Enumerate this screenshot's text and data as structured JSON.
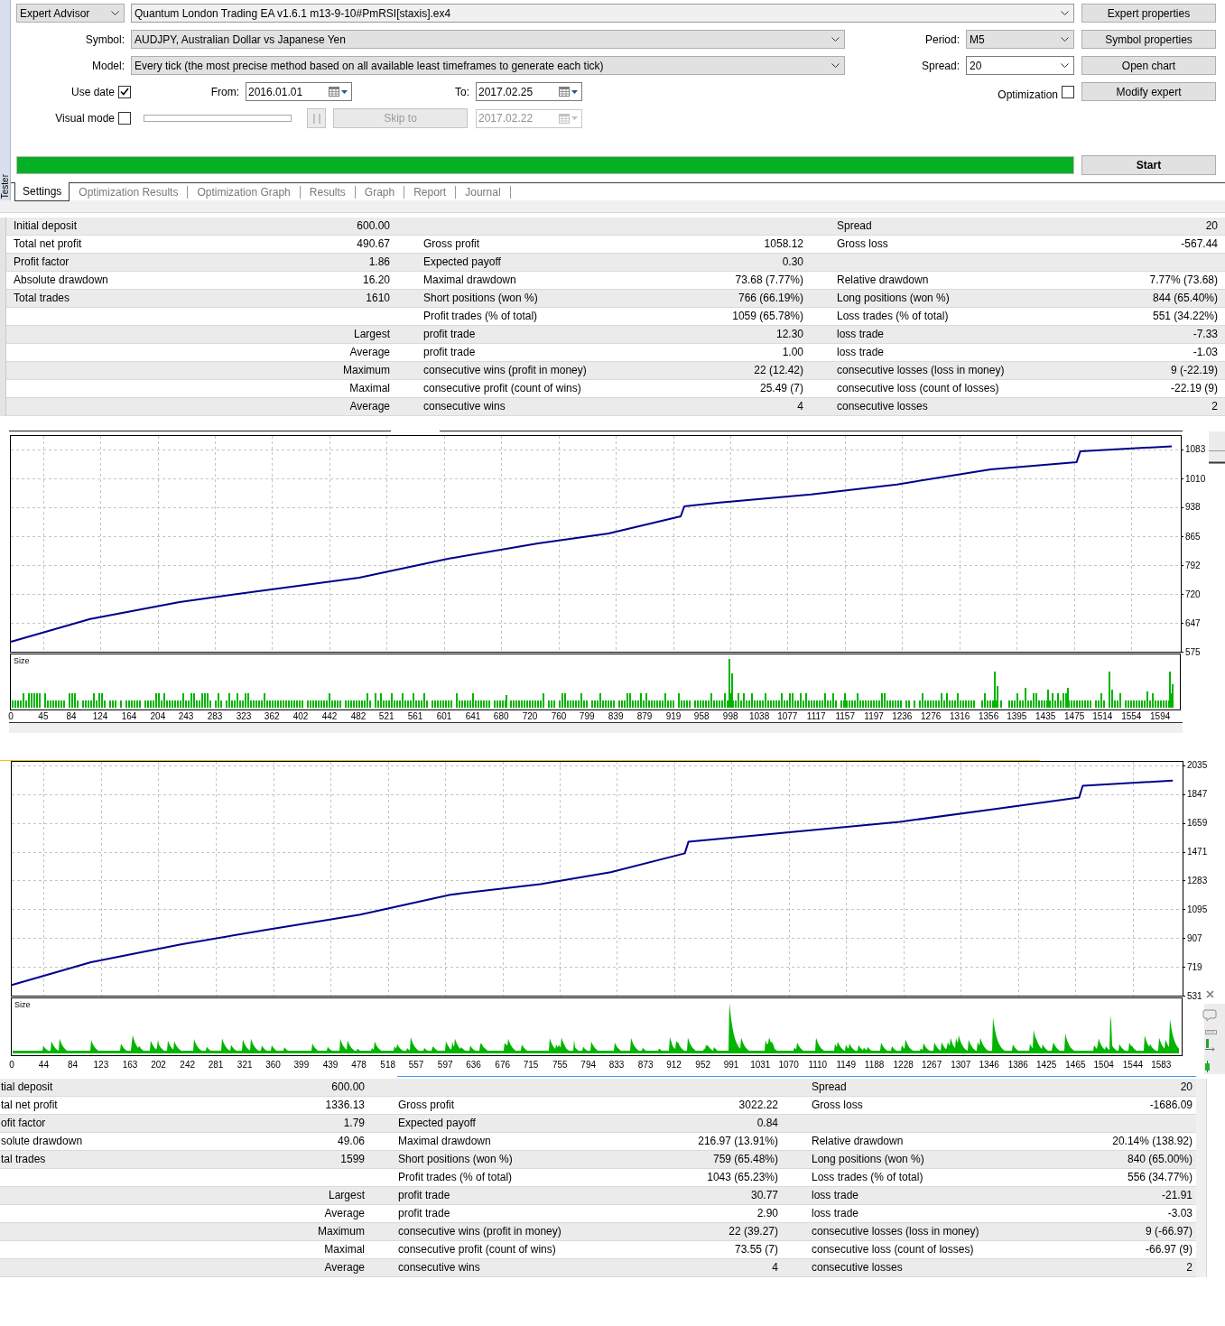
{
  "side_tab": {
    "label": "Tester"
  },
  "settings": {
    "expert_type": {
      "value": "Expert Advisor",
      "editable": false
    },
    "expert_file": {
      "value": "Quantum London Trading EA v1.6.1 m13-9-10#PmRSI[staxis].ex4",
      "editable": false
    },
    "expert_properties_button": {
      "label": "Expert properties"
    },
    "symbol": {
      "label": "Symbol:",
      "value": "AUDJPY, Australian Dollar vs Japanese Yen",
      "editable": false
    },
    "period": {
      "label": "Period:",
      "value": "M5",
      "editable": false
    },
    "symbol_properties_button": {
      "label": "Symbol properties"
    },
    "model": {
      "label": "Model:",
      "value": "Every tick (the most precise method based on all available least timeframes to generate each tick)",
      "editable": false
    },
    "spread": {
      "label": "Spread:",
      "value": "20",
      "editable": true
    },
    "open_chart_button": {
      "label": "Open chart"
    },
    "use_date": {
      "label": "Use date",
      "checked": true
    },
    "from": {
      "label": "From:",
      "value": "2016.01.01"
    },
    "to": {
      "label": "To:",
      "value": "2017.02.25"
    },
    "optimization": {
      "label": "Optimization",
      "checked": false
    },
    "modify_expert_button": {
      "label": "Modify expert"
    },
    "visual_mode": {
      "label": "Visual mode",
      "checked": false
    },
    "pause_button": {
      "disabled": true
    },
    "skip_button": {
      "label": "Skip to",
      "disabled": true
    },
    "skip_date": {
      "value": "2017.02.22",
      "disabled": true
    },
    "progress": {
      "level": 1
    },
    "start_button": {
      "label": "Start"
    }
  },
  "tabs": [
    {
      "label": "Settings",
      "selected": true
    },
    {
      "label": "Optimization Results",
      "selected": false
    },
    {
      "label": "Optimization Graph",
      "selected": false
    },
    {
      "label": "Results",
      "selected": false
    },
    {
      "label": "Graph",
      "selected": false
    },
    {
      "label": "Report",
      "selected": false
    },
    {
      "label": "Journal",
      "selected": false
    }
  ],
  "results_1": {
    "rows": [
      {
        "col_1": "Initial deposit",
        "col_2": "600.00",
        "col_5": "Spread",
        "col_6": "20"
      },
      {
        "col_1": "Total net profit",
        "col_2": "490.67",
        "col_3": "Gross profit",
        "col_4": "1058.12",
        "col_5": "Gross loss",
        "col_6": "-567.44"
      },
      {
        "col_1": "Profit factor",
        "col_2": "1.86",
        "col_3": "Expected payoff",
        "col_4": "0.30"
      },
      {
        "col_1": "Absolute drawdown",
        "col_2": "16.20",
        "col_3": "Maximal drawdown",
        "col_4": "73.68 (7.77%)",
        "col_5": "Relative drawdown",
        "col_6": "7.77% (73.68)"
      },
      {
        "col_1": "Total trades",
        "col_2": "1610",
        "col_3": "Short positions (won %)",
        "col_4": "766 (66.19%)",
        "col_5": "Long positions (won %)",
        "col_6": "844 (65.40%)"
      },
      {
        "col_3": "Profit trades (% of total)",
        "col_4": "1059 (65.78%)",
        "col_5": "Loss trades (% of total)",
        "col_6": "551 (34.22%)"
      },
      {
        "col_2": "Largest",
        "col_3": "profit trade",
        "col_4": "12.30",
        "col_5": "loss trade",
        "col_6": "-7.33"
      },
      {
        "col_2": "Average",
        "col_3": "profit trade",
        "col_4": "1.00",
        "col_5": "loss trade",
        "col_6": "-1.03"
      },
      {
        "col_2": "Maximum",
        "col_3": "consecutive wins (profit in money)",
        "col_4": "22 (12.42)",
        "col_5": "consecutive losses (loss in money)",
        "col_6": "9 (-22.19)"
      },
      {
        "col_2": "Maximal",
        "col_3": "consecutive profit (count of wins)",
        "col_4": "25.49 (7)",
        "col_5": "consecutive loss (count of losses)",
        "col_6": "-22.19 (9)"
      },
      {
        "col_2": "Average",
        "col_3": "consecutive wins",
        "col_4": "4",
        "col_5": "consecutive losses",
        "col_6": "2"
      }
    ]
  },
  "chart_1": {
    "size_label": "Size",
    "chart_data": {
      "type": "line",
      "grid": true,
      "x": [
        0,
        110,
        234,
        359,
        483,
        608,
        731,
        829,
        929,
        934,
        980,
        1110,
        1229,
        1359,
        1478,
        1483,
        1610
      ],
      "series": [
        {
          "color": "#00008b",
          "values": [
            600,
            657,
            700,
            731,
            761,
            809,
            847,
            872,
            915,
            940,
            949,
            970,
            995,
            1033,
            1051,
            1078,
            1091
          ]
        }
      ],
      "xlim": [
        0,
        1620
      ],
      "ylim": [
        575,
        1119
      ],
      "xticks": [
        0,
        45,
        84,
        124,
        164,
        204,
        243,
        283,
        323,
        362,
        402,
        442,
        482,
        521,
        561,
        601,
        641,
        680,
        720,
        760,
        799,
        839,
        879,
        919,
        958,
        998,
        1038,
        1077,
        1117,
        1157,
        1197,
        1236,
        1276,
        1316,
        1356,
        1395,
        1435,
        1475,
        1514,
        1554,
        1594
      ],
      "yticks": [
        575,
        647,
        720,
        792,
        865,
        938,
        1010,
        1083
      ]
    }
  },
  "chart_2": {
    "size_label": "Size",
    "chart_data": {
      "type": "line",
      "grid": true,
      "x": [
        0,
        109,
        233,
        357,
        480,
        604,
        728,
        825,
        927,
        932,
        975,
        1104,
        1223,
        1352,
        1470,
        1475,
        1599
      ],
      "series": [
        {
          "color": "#00008b",
          "values": [
            600,
            749,
            866,
            966,
            1060,
            1190,
            1260,
            1337,
            1460,
            1537,
            1555,
            1613,
            1666,
            1749,
            1825,
            1902,
            1936
          ]
        }
      ],
      "xlim": [
        0,
        1610
      ],
      "ylim": [
        531,
        2064
      ],
      "xticks": [
        0,
        44,
        84,
        123,
        163,
        202,
        242,
        281,
        321,
        360,
        399,
        439,
        478,
        518,
        557,
        597,
        636,
        676,
        715,
        755,
        794,
        833,
        873,
        912,
        952,
        991,
        1031,
        1070,
        1110,
        1149,
        1188,
        1228,
        1267,
        1307,
        1346,
        1386,
        1425,
        1465,
        1504,
        1544,
        1583
      ],
      "yticks": [
        531,
        719,
        907,
        1095,
        1283,
        1471,
        1659,
        1847,
        2035
      ]
    }
  },
  "results_2": {
    "rows": [
      {
        "col_1": "tial deposit",
        "col_2": "600.00",
        "col_5": "Spread",
        "col_6": "20"
      },
      {
        "col_1": "tal net profit",
        "col_2": "1336.13",
        "col_3": "Gross profit",
        "col_4": "3022.22",
        "col_5": "Gross loss",
        "col_6": "-1686.09"
      },
      {
        "col_1": "ofit factor",
        "col_2": "1.79",
        "col_3": "Expected payoff",
        "col_4": "0.84"
      },
      {
        "col_1": "solute drawdown",
        "col_2": "49.06",
        "col_3": "Maximal drawdown",
        "col_4": "216.97 (13.91%)",
        "col_5": "Relative drawdown",
        "col_6": "20.14% (138.92)"
      },
      {
        "col_1": "tal trades",
        "col_2": "1599",
        "col_3": "Short positions (won %)",
        "col_4": "759 (65.48%)",
        "col_5": "Long positions (won %)",
        "col_6": "840 (65.00%)"
      },
      {
        "col_3": "Profit trades (% of total)",
        "col_4": "1043 (65.23%)",
        "col_5": "Loss trades (% of total)",
        "col_6": "556 (34.77%)"
      },
      {
        "col_2": "Largest",
        "col_3": "profit trade",
        "col_4": "30.77",
        "col_5": "loss trade",
        "col_6": "-21.91"
      },
      {
        "col_2": "Average",
        "col_3": "profit trade",
        "col_4": "2.90",
        "col_5": "loss trade",
        "col_6": "-3.03"
      },
      {
        "col_2": "Maximum",
        "col_3": "consecutive wins (profit in money)",
        "col_4": "22 (39.27)",
        "col_5": "consecutive losses (loss in money)",
        "col_6": "9 (-66.97)"
      },
      {
        "col_2": "Maximal",
        "col_3": "consecutive profit (count of wins)",
        "col_4": "73.55 (7)",
        "col_5": "consecutive loss (count of losses)",
        "col_6": "-66.97 (9)"
      },
      {
        "col_2": "Average",
        "col_3": "consecutive wins",
        "col_4": "4",
        "col_5": "consecutive losses",
        "col_6": "2"
      }
    ]
  }
}
